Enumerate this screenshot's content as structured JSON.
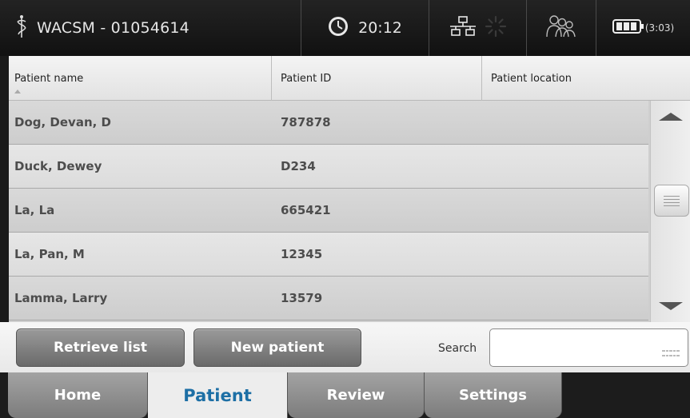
{
  "status_bar": {
    "device_label": "WACSM - 01054614",
    "clock_time": "20:12",
    "battery_time": "(3:03)",
    "icons": [
      "caduceus-icon",
      "clock-icon",
      "network-icon",
      "wireless-icon",
      "patients-icon",
      "battery-icon"
    ]
  },
  "patient_table": {
    "columns": [
      "Patient name",
      "Patient ID",
      "Patient location"
    ],
    "rows": [
      {
        "name": "Dog, Devan, D",
        "id": "787878",
        "location": ""
      },
      {
        "name": "Duck, Dewey",
        "id": "D234",
        "location": ""
      },
      {
        "name": "La, La",
        "id": "665421",
        "location": ""
      },
      {
        "name": "La, Pan, M",
        "id": "12345",
        "location": ""
      },
      {
        "name": "Lamma, Larry",
        "id": "13579",
        "location": ""
      }
    ]
  },
  "actions": {
    "retrieve_label": "Retrieve list",
    "new_patient_label": "New patient",
    "search_label": "Search",
    "search_value": ""
  },
  "nav": {
    "tabs": [
      "Home",
      "Patient",
      "Review",
      "Settings"
    ],
    "active": "Patient"
  },
  "colors": {
    "active_tab_text": "#1d6fa5",
    "topbar_bg": "#1a1a1a"
  }
}
